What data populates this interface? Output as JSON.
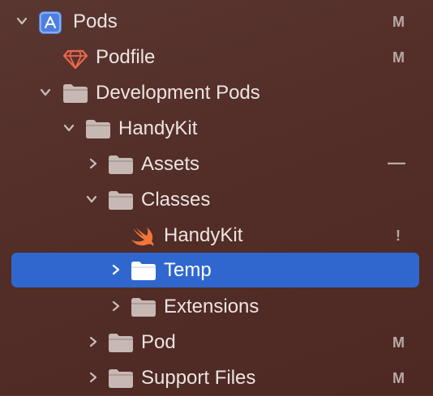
{
  "navigator": {
    "rows": [
      {
        "label": "Pods",
        "status": "M",
        "icon": "xcode-project-icon",
        "disclosure": "expanded"
      },
      {
        "label": "Podfile",
        "status": "M",
        "icon": "ruby-gem-icon",
        "disclosure": "none"
      },
      {
        "label": "Development Pods",
        "status": "",
        "icon": "folder-icon",
        "disclosure": "expanded"
      },
      {
        "label": "HandyKit",
        "status": "",
        "icon": "folder-icon",
        "disclosure": "expanded"
      },
      {
        "label": "Assets",
        "status": "—",
        "icon": "folder-icon",
        "disclosure": "collapsed"
      },
      {
        "label": "Classes",
        "status": "",
        "icon": "folder-icon",
        "disclosure": "expanded"
      },
      {
        "label": "HandyKit",
        "status": "!",
        "icon": "swift-file-icon",
        "disclosure": "none"
      },
      {
        "label": "Temp",
        "status": "",
        "icon": "folder-icon",
        "disclosure": "collapsed",
        "selected": true
      },
      {
        "label": "Extensions",
        "status": "",
        "icon": "folder-icon",
        "disclosure": "collapsed"
      },
      {
        "label": "Pod",
        "status": "M",
        "icon": "folder-icon",
        "disclosure": "collapsed"
      },
      {
        "label": "Support Files",
        "status": "M",
        "icon": "folder-icon",
        "disclosure": "collapsed"
      }
    ]
  },
  "colors": {
    "background": "#532d27",
    "selection": "#2f67cf",
    "text": "#ece4e2",
    "status": "#b9a9a5",
    "folder": "#c8b8b4",
    "swift": "#f0763b",
    "gem": "#e9684e",
    "project": "#4e7fe0"
  }
}
